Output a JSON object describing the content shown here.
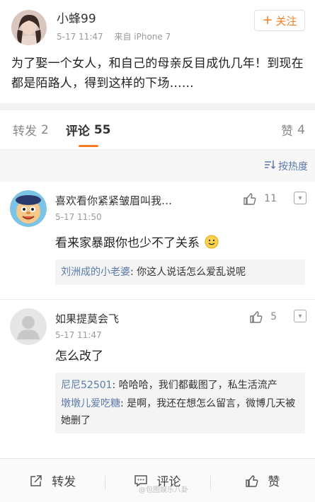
{
  "post": {
    "author": "小蜂99",
    "date": "5-17 11:47",
    "source": "来自 iPhone 7",
    "follow_label": "关注",
    "text": "为了娶一个女人，和自己的母亲反目成仇几年！到现在都是陌路人，得到这样的下场……"
  },
  "tabs": {
    "repost_label": "转发",
    "repost_count": "2",
    "comment_label": "评论",
    "comment_count": "55",
    "like_label": "赞",
    "like_count": "4"
  },
  "sort": {
    "label": "按热度"
  },
  "comments": [
    {
      "name": "喜欢看你紧紧皱眉叫我…",
      "time": "5-17 11:50",
      "likes": "11",
      "text": "看来家暴跟你也少不了关系",
      "replies": [
        {
          "name": "刘洲成的小老婆",
          "text": "你这人说话怎么爱乱说呢"
        }
      ]
    },
    {
      "name": "如果提莫会飞",
      "time": "5-17 11:47",
      "likes": "5",
      "text": "怎么改了",
      "replies": [
        {
          "name": "尼尼52501",
          "text": "哈哈哈，我们都截图了，私生活流产"
        },
        {
          "name": "墩墩儿爱吃糖",
          "text": "是啊，我还在想怎么留言，微博几天被她删了"
        }
      ]
    }
  ],
  "bottom_bar": {
    "repost": "转发",
    "comment": "评论",
    "like": "赞"
  },
  "watermark": "@包图娱乐八卦"
}
